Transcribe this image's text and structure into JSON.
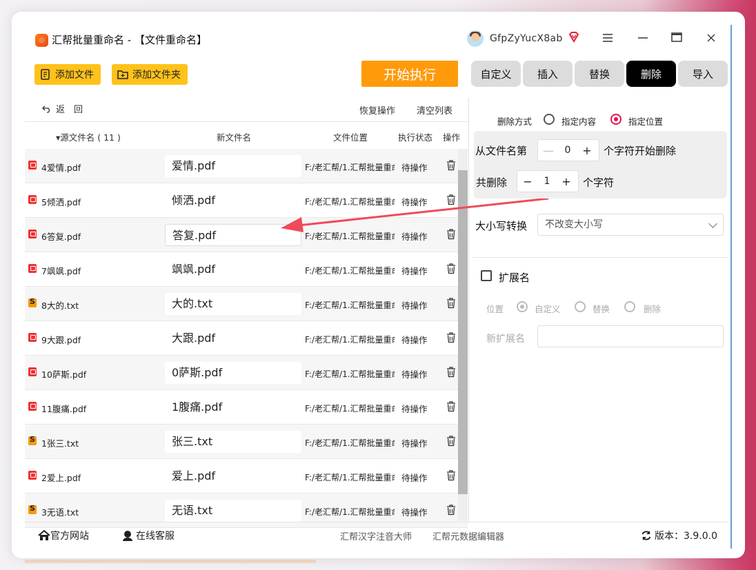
{
  "window": {
    "title": "汇帮批量重命名 - 【文件重命名】",
    "username": "GfpZyYucX8ab"
  },
  "toolbar": {
    "add_file": "添加文件",
    "add_folder": "添加文件夹",
    "start": "开始执行"
  },
  "tabs": [
    "自定义",
    "插入",
    "替换",
    "删除",
    "导入"
  ],
  "active_tab": "删除",
  "list_actions": {
    "back": "返回",
    "restore": "恢复操作",
    "clear": "清空列表"
  },
  "columns": {
    "source": "▾源文件名 ( 11 )",
    "new": "新文件名",
    "location": "文件位置",
    "status": "执行状态",
    "action": "操作"
  },
  "rows": [
    {
      "type": "pdf",
      "source": "4爱情.pdf",
      "new": "爱情.pdf",
      "location": "F:/老汇帮/1.汇帮批量重命",
      "status": "待操作"
    },
    {
      "type": "pdf",
      "source": "5倾洒.pdf",
      "new": "倾洒.pdf",
      "location": "F:/老汇帮/1.汇帮批量重命",
      "status": "待操作"
    },
    {
      "type": "pdf",
      "source": "6答复.pdf",
      "new": "答复.pdf",
      "location": "F:/老汇帮/1.汇帮批量重命",
      "status": "待操作"
    },
    {
      "type": "pdf",
      "source": "7飒飒.pdf",
      "new": "飒飒.pdf",
      "location": "F:/老汇帮/1.汇帮批量重命",
      "status": "待操作"
    },
    {
      "type": "txt",
      "source": "8大的.txt",
      "new": "大的.txt",
      "location": "F:/老汇帮/1.汇帮批量重命",
      "status": "待操作"
    },
    {
      "type": "pdf",
      "source": "9大跟.pdf",
      "new": "大跟.pdf",
      "location": "F:/老汇帮/1.汇帮批量重命",
      "status": "待操作"
    },
    {
      "type": "pdf",
      "source": "10萨斯.pdf",
      "new": "0萨斯.pdf",
      "location": "F:/老汇帮/1.汇帮批量重命",
      "status": "待操作"
    },
    {
      "type": "pdf",
      "source": "11腹痛.pdf",
      "new": "1腹痛.pdf",
      "location": "F:/老汇帮/1.汇帮批量重命",
      "status": "待操作"
    },
    {
      "type": "txt",
      "source": "1张三.txt",
      "new": "张三.txt",
      "location": "F:/老汇帮/1.汇帮批量重命",
      "status": "待操作"
    },
    {
      "type": "pdf",
      "source": "2爱上.pdf",
      "new": "爱上.pdf",
      "location": "F:/老汇帮/1.汇帮批量重命",
      "status": "待操作"
    },
    {
      "type": "txt",
      "source": "3无语.txt",
      "new": "无语.txt",
      "location": "F:/老汇帮/1.汇帮批量重命",
      "status": "待操作"
    }
  ],
  "delete_panel": {
    "mode_label": "删除方式",
    "mode_content": "指定内容",
    "mode_position": "指定位置",
    "from_prefix": "从文件名第",
    "from_value": "0",
    "from_suffix": "个字符开始删除",
    "count_prefix": "共删除",
    "count_value": "1",
    "count_suffix": "个字符",
    "case_label": "大小写转换",
    "case_value": "不改变大小写",
    "ext_label": "扩展名",
    "ext_position_label": "位置",
    "ext_opt_custom": "自定义",
    "ext_opt_replace": "替换",
    "ext_opt_delete": "删除",
    "new_ext_label": "新扩展名",
    "new_ext_value": ""
  },
  "footer": {
    "website": "官方网站",
    "support": "在线客服",
    "link1": "汇帮汉字注音大师",
    "link2": "汇帮元数据编辑器",
    "version": "版本：3.9.0.0"
  },
  "colors": {
    "accent_yellow": "#ffc21a",
    "start_orange": "#ff9a0a",
    "radio_active": "#e01550",
    "annotation_arrow": "#f04a5a"
  }
}
